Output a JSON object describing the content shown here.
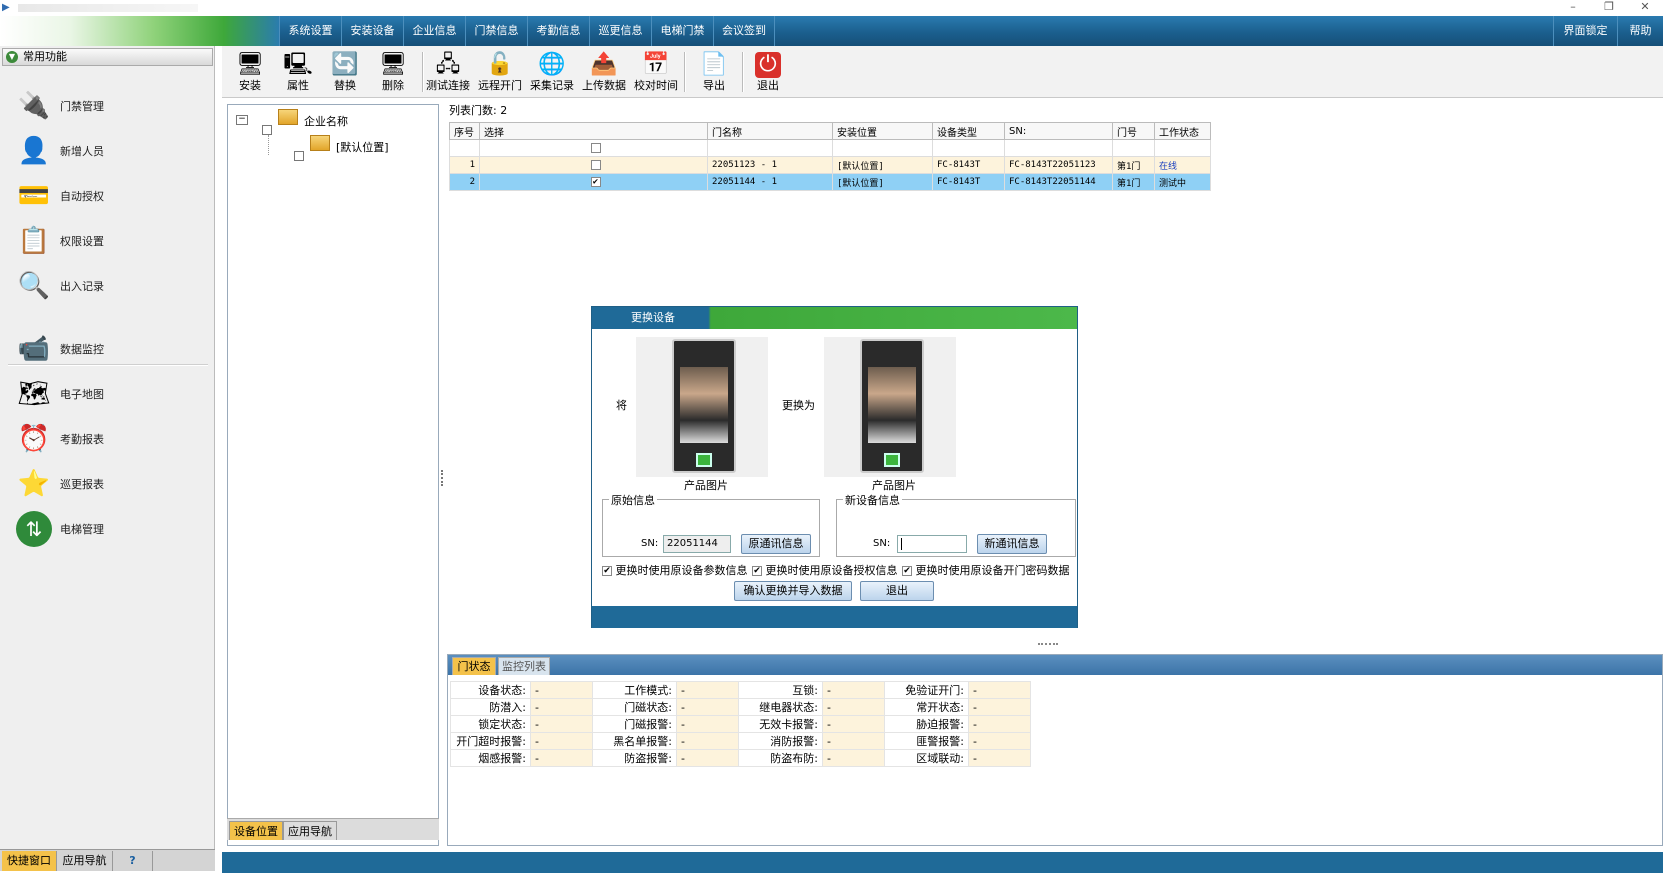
{
  "menu": [
    "系统设置",
    "安装设备",
    "企业信息",
    "门禁信息",
    "考勤信息",
    "巡更信息",
    "电梯门禁",
    "会议签到"
  ],
  "menu_right": [
    "界面锁定",
    "帮助"
  ],
  "window_buttons": [
    "–",
    "❐",
    "✕"
  ],
  "left_panel": {
    "header": "常用功能",
    "items": [
      {
        "label": "门禁管理",
        "icon": "door-control-icon",
        "glyph": "🔌"
      },
      {
        "label": "新增人员",
        "icon": "person-icon",
        "glyph": "👤"
      },
      {
        "label": "自动授权",
        "icon": "card-icon",
        "glyph": "💳"
      },
      {
        "label": "权限设置",
        "icon": "permission-icon",
        "glyph": "📋"
      },
      {
        "label": "出入记录",
        "icon": "search-record-icon",
        "glyph": "🔍"
      },
      {
        "label": "数据监控",
        "icon": "camera-icon",
        "glyph": "📹"
      },
      {
        "label": "电子地图",
        "icon": "map-icon",
        "glyph": "🗺"
      },
      {
        "label": "考勤报表",
        "icon": "clock-icon",
        "glyph": "⏰"
      },
      {
        "label": "巡更报表",
        "icon": "patrol-icon",
        "glyph": "⭐"
      },
      {
        "label": "电梯管理",
        "icon": "elevator-icon",
        "glyph": "⇅"
      }
    ],
    "tabs": [
      "快捷窗口",
      "应用导航",
      "?"
    ]
  },
  "toolbar": [
    {
      "label": "安装",
      "icon": "install-icon",
      "glyph": "🖥"
    },
    {
      "label": "属性",
      "icon": "properties-icon",
      "glyph": "🖳"
    },
    {
      "label": "替换",
      "icon": "replace-icon",
      "glyph": "🔄"
    },
    {
      "label": "删除",
      "icon": "delete-icon",
      "glyph": "🖥"
    },
    {
      "label": "测试连接",
      "icon": "test-connection-icon",
      "glyph": "🖧"
    },
    {
      "label": "远程开门",
      "icon": "remote-open-icon",
      "glyph": "🔓"
    },
    {
      "label": "采集记录",
      "icon": "collect-record-icon",
      "glyph": "🌐"
    },
    {
      "label": "上传数据",
      "icon": "upload-icon",
      "glyph": "📤"
    },
    {
      "label": "校对时间",
      "icon": "calendar-icon",
      "glyph": "📅"
    },
    {
      "label": "导出",
      "icon": "export-icon",
      "glyph": "📄"
    },
    {
      "label": "退出",
      "icon": "power-icon",
      "glyph": "⏻"
    }
  ],
  "tree": {
    "root": "企业名称",
    "child": "[默认位置]",
    "tabs": [
      "设备位置",
      "应用导航"
    ]
  },
  "grid": {
    "count_label": "列表门数: 2",
    "columns": [
      "序号",
      "选择",
      "门名称",
      "安装位置",
      "设备类型",
      "SN:",
      "门号",
      "工作状态"
    ],
    "rows": [
      {
        "no": "1",
        "checked": false,
        "name": "22051123 - 1",
        "location": "[默认位置]",
        "type": "FC-8143T",
        "sn": "FC-8143T22051123",
        "door": "第1门",
        "status": "在线"
      },
      {
        "no": "2",
        "checked": true,
        "name": "22051144 - 1",
        "location": "[默认位置]",
        "type": "FC-8143T",
        "sn": "FC-8143T22051144",
        "door": "第1门",
        "status": "测试中"
      }
    ]
  },
  "dialog": {
    "title": "更换设备",
    "from_label": "将",
    "to_label": "更换为",
    "product_image_label": "产品图片",
    "original_legend": "原始信息",
    "new_legend": "新设备信息",
    "sn_label": "SN:",
    "original_sn": "22051144",
    "new_sn": "",
    "orig_comm_button": "原通讯信息",
    "new_comm_button": "新通讯信息",
    "checks": [
      {
        "label": "更换时使用原设备参数信息",
        "checked": true
      },
      {
        "label": "更换时使用原设备授权信息",
        "checked": true
      },
      {
        "label": "更换时使用原设备开门密码数据",
        "checked": true
      }
    ],
    "confirm_button": "确认更换并导入数据",
    "exit_button": "退出"
  },
  "status_panel": {
    "tabs": [
      "门状态",
      "监控列表"
    ],
    "rows": [
      [
        [
          "设备状态:",
          "-"
        ],
        [
          "工作模式:",
          "-"
        ],
        [
          "互锁:",
          "-"
        ],
        [
          "免验证开门:",
          "-"
        ]
      ],
      [
        [
          "防潜入:",
          "-"
        ],
        [
          "门磁状态:",
          "-"
        ],
        [
          "继电器状态:",
          "-"
        ],
        [
          "常开状态:",
          "-"
        ]
      ],
      [
        [
          "锁定状态:",
          "-"
        ],
        [
          "门磁报警:",
          "-"
        ],
        [
          "无效卡报警:",
          "-"
        ],
        [
          "胁迫报警:",
          "-"
        ]
      ],
      [
        [
          "开门超时报警:",
          "-"
        ],
        [
          "黑名单报警:",
          "-"
        ],
        [
          "消防报警:",
          "-"
        ],
        [
          "匪警报警:",
          "-"
        ]
      ],
      [
        [
          "烟感报警:",
          "-"
        ],
        [
          "防盗报警:",
          "-"
        ],
        [
          "防盗布防:",
          "-"
        ],
        [
          "区域联动:",
          "-"
        ]
      ]
    ]
  },
  "colors": {
    "menubar": "#1b5f8e",
    "accent_green": "#3ea83a",
    "selected_row": "#8fd0f5",
    "online": "#1a3fbf"
  }
}
